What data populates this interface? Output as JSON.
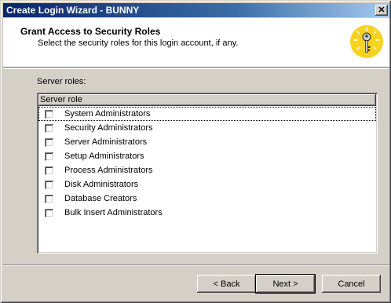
{
  "window": {
    "title": "Create Login Wizard - BUNNY",
    "close_glyph": "✕"
  },
  "header": {
    "title": "Grant Access to Security Roles",
    "subtitle": "Select the security roles for this login account, if any.",
    "icon": "key-icon"
  },
  "roles": {
    "label": "Server roles:",
    "column_header": "Server role",
    "items": [
      {
        "label": "System Administrators",
        "checked": false
      },
      {
        "label": "Security Administrators",
        "checked": false
      },
      {
        "label": "Server Administrators",
        "checked": false
      },
      {
        "label": "Setup Administrators",
        "checked": false
      },
      {
        "label": "Process Administrators",
        "checked": false
      },
      {
        "label": "Disk Administrators",
        "checked": false
      },
      {
        "label": "Database Creators",
        "checked": false
      },
      {
        "label": "Bulk Insert Administrators",
        "checked": false
      }
    ]
  },
  "buttons": {
    "back": "< Back",
    "next": "Next >",
    "cancel": "Cancel"
  }
}
